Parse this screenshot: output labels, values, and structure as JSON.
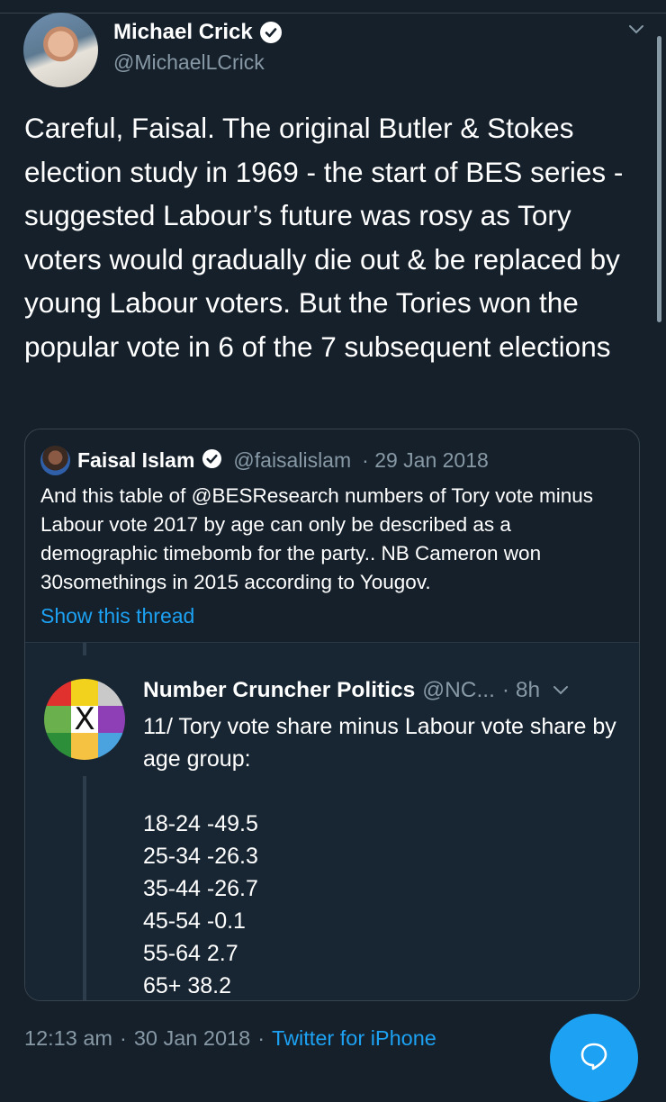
{
  "tweet": {
    "author_name": "Michael Crick",
    "author_handle": "@MichaelLCrick",
    "text": "Careful, Faisal. The original Butler & Stokes election study in 1969 - the start of BES series - suggested Labour’s future was rosy as Tory voters would gradually die out & be replaced by young Labour voters. But the Tories won the popular vote in 6 of the 7 subsequent elections",
    "time": "12:13 am",
    "date": "30 Jan 2018",
    "separator": "·",
    "source": "Twitter for iPhone"
  },
  "quote": {
    "author_name": "Faisal Islam",
    "author_handle": "@faisalislam",
    "date_line": "· 29 Jan 2018",
    "text": "And this table of @BESResearch numbers of Tory vote minus Labour vote 2017 by age can only be described as a demographic timebomb for the party.. NB Cameron won 30somethings in 2015 according to Yougov.",
    "show_thread": "Show this thread"
  },
  "embedded": {
    "author_name": "Number Cruncher Politics",
    "author_handle": "@NC...",
    "time": "· 8h",
    "avatar_mark": "X",
    "intro": "11/ Tory vote share minus Labour vote share by age group:",
    "lines": [
      "18-24 -49.5",
      "25-34 -26.3",
      "35-44 -26.7",
      "45-54 -0.1",
      "55-64 2.7",
      "65+ 38.2"
    ]
  },
  "colors": {
    "background": "#15202b",
    "accent": "#1da1f2",
    "secondary_text": "#8899a6",
    "border": "#38444d"
  },
  "icons": {
    "verified": "verified-badge-icon",
    "caret": "chevron-down-icon",
    "reply_fab": "reply-bubble-icon"
  }
}
